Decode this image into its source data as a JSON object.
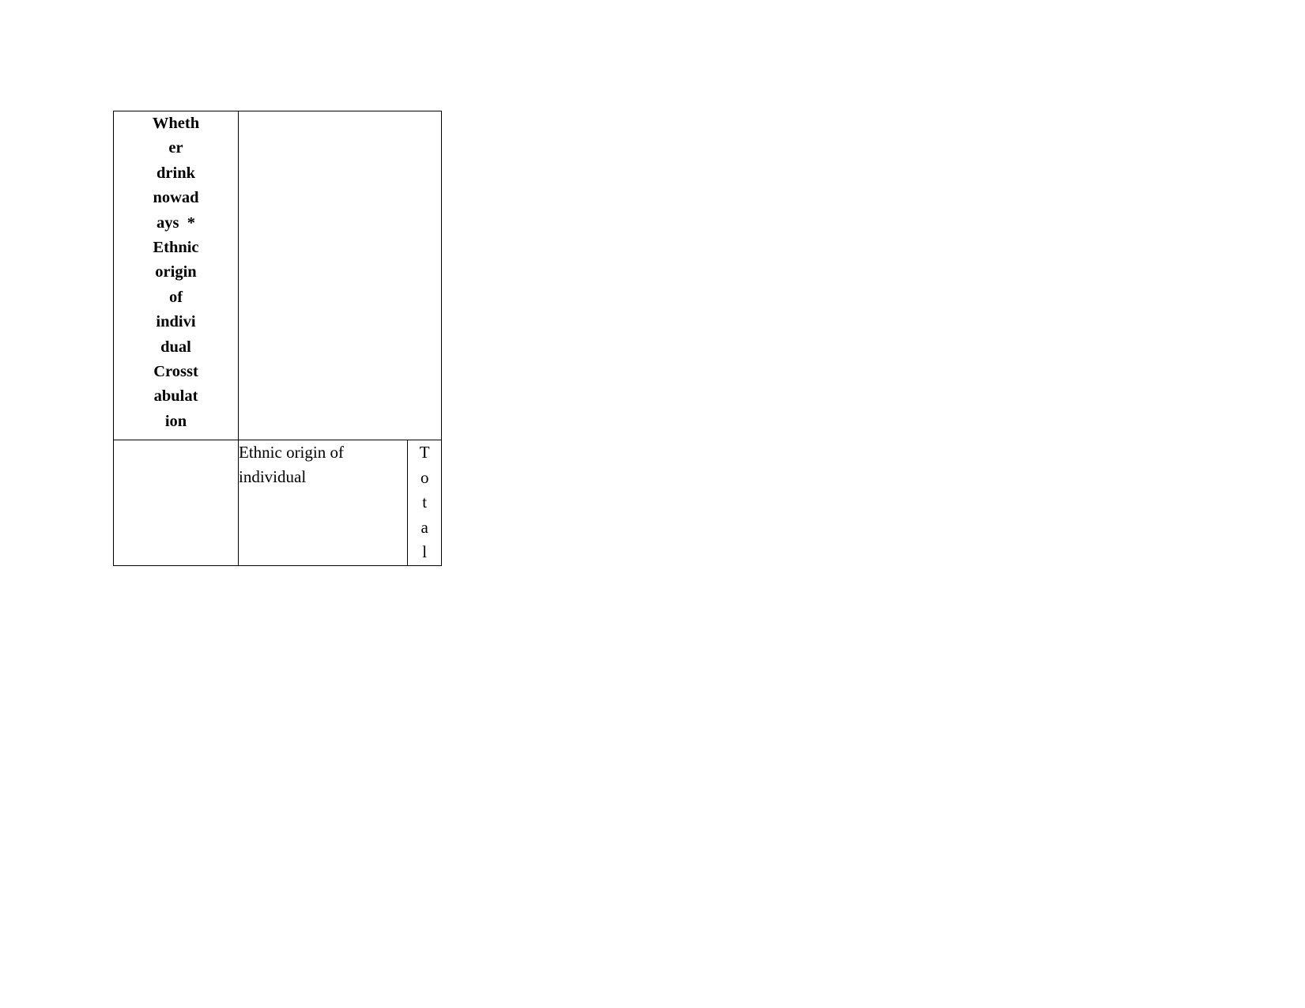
{
  "document": {
    "background_color": "#ffffff",
    "text_color": "#000000",
    "border_color": "#000000"
  },
  "table": {
    "name": "Whether drink nowadays * Ethnic origin of individual Crosstabulation",
    "stub_header": {
      "full_text": "Whether drink nowadays * Ethnic origin of individual Crosstabulation",
      "wrapped_lines": [
        "Wheth",
        "er",
        "drink",
        "nowad",
        "ays  *",
        "Ethnic",
        "origin",
        "of",
        "indivi",
        "dual",
        "Crosst",
        "abulat",
        "ion"
      ]
    },
    "row2": {
      "stub_blank": "",
      "column_group_header": "Ethnic origin of individual",
      "total_header": {
        "full_text": "Total",
        "wrapped_lines": [
          "T",
          "o",
          "t",
          "a",
          "l"
        ]
      }
    }
  }
}
